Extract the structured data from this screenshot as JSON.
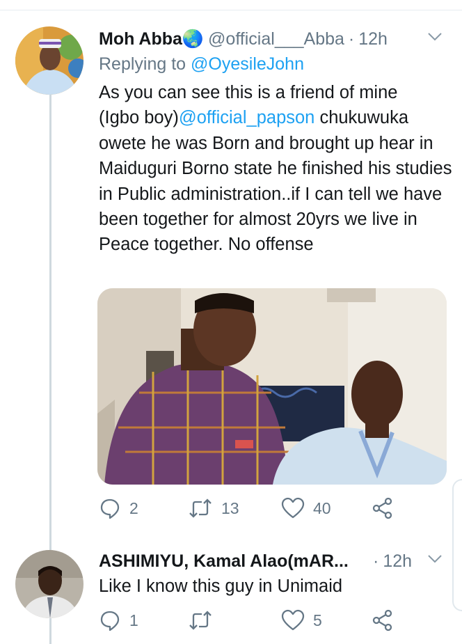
{
  "tweet1": {
    "name": "Moh Abba",
    "name_emoji": "🌏",
    "handle": "@official___Abba",
    "dot": "·",
    "time": "12h",
    "replying_prefix": "Replying to ",
    "replying_handle": "@OyesileJohn",
    "text_line1": "As you can see this is a friend of mine",
    "text_line2_pre": "(Igbo boy)",
    "text_mention": "@official_papson",
    "text_line2_post": " chukuwuka",
    "text_rest": "owete he was Born and brought up hear in Maiduguri Borno state he finished his studies in Public administration..if I can tell we have been together for almost 20yrs we live in Peace together. No offense",
    "replies": "2",
    "retweets": "13",
    "likes": "40"
  },
  "tweet2": {
    "name": "ASHIMIYU, Kamal Alao(mAR...",
    "dot": "·",
    "time": "12h",
    "text": "Like I know this guy in Unimaid",
    "replies": "1",
    "retweets": "",
    "likes": "5"
  },
  "icons": [
    "reply-icon",
    "retweet-icon",
    "like-icon",
    "share-icon",
    "chevron-down-icon"
  ],
  "colors": {
    "link": "#1da1f2",
    "muted": "#657786",
    "text": "#14171a",
    "thread": "#cfd9de"
  }
}
